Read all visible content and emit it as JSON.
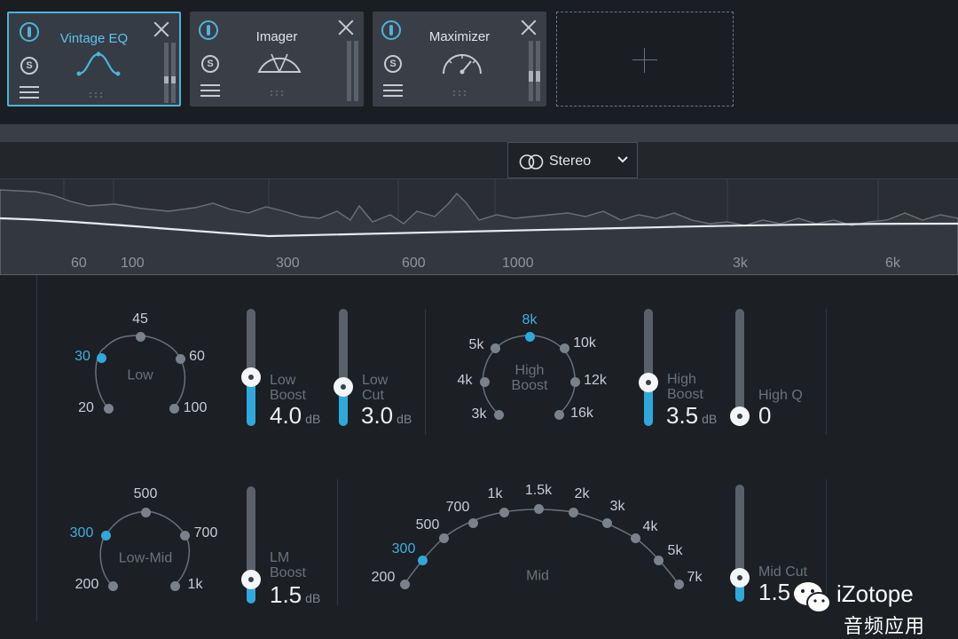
{
  "modules": [
    {
      "title": "Vintage EQ",
      "solo": "S",
      "graphic": "eq-bell-icon",
      "selected": true
    },
    {
      "title": "Imager",
      "solo": "S",
      "graphic": "stereo-fan-icon",
      "selected": false
    },
    {
      "title": "Maximizer",
      "solo": "S",
      "graphic": "speedometer-icon",
      "selected": false
    }
  ],
  "toolbar": {
    "stereo_mode": "Stereo"
  },
  "spectrum": {
    "frequency_labels": [
      "60",
      "100",
      "300",
      "600",
      "1000",
      "3k",
      "6k"
    ]
  },
  "low_dial": {
    "name": "Low",
    "options": [
      "20",
      "30",
      "45",
      "60",
      "100"
    ],
    "selected": "30"
  },
  "high_boost_dial": {
    "name_line1": "High",
    "name_line2": "Boost",
    "options": [
      "3k",
      "4k",
      "5k",
      "8k",
      "10k",
      "12k",
      "16k"
    ],
    "selected": "8k"
  },
  "low_mid_dial": {
    "name": "Low-Mid",
    "options": [
      "200",
      "300",
      "500",
      "700",
      "1k"
    ],
    "selected": "300"
  },
  "mid_dial": {
    "name": "Mid",
    "options": [
      "200",
      "300",
      "500",
      "700",
      "1k",
      "1.5k",
      "2k",
      "3k",
      "4k",
      "5k",
      "7k"
    ],
    "selected": "300"
  },
  "sliders": {
    "low_boost": {
      "line1": "Low",
      "line2": "Boost",
      "value": "4.0",
      "unit": "dB",
      "level": 0.4
    },
    "low_cut": {
      "line1": "Low",
      "line2": "Cut",
      "value": "3.0",
      "unit": "dB",
      "level": 0.3
    },
    "high_boost": {
      "line1": "High",
      "line2": "Boost",
      "value": "3.5",
      "unit": "dB",
      "level": 0.35
    },
    "high_q": {
      "line1": "High Q",
      "value": "0",
      "level": 0.0
    },
    "lm_boost": {
      "line1": "LM",
      "line2": "Boost",
      "value": "1.5",
      "unit": "dB",
      "level": 0.15
    },
    "mid_cut": {
      "line1": "Mid Cut",
      "value": "1.5",
      "level": 0.15
    }
  },
  "watermark": {
    "brand": "iZotope",
    "subtitle": "音频应用"
  }
}
